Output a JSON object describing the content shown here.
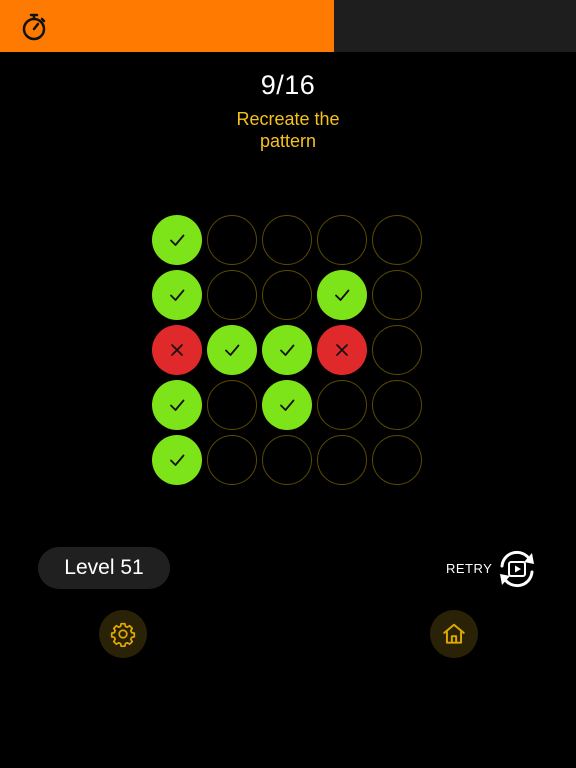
{
  "timer": {
    "remaining_fraction": 0.58,
    "icon": "stopwatch-icon"
  },
  "progress": {
    "text": "9/16"
  },
  "instruction": "Recreate the pattern",
  "grid": {
    "size": 5,
    "cells": [
      "correct",
      "empty",
      "empty",
      "empty",
      "empty",
      "correct",
      "empty",
      "empty",
      "correct",
      "empty",
      "wrong",
      "correct",
      "correct",
      "wrong",
      "empty",
      "correct",
      "empty",
      "correct",
      "empty",
      "empty",
      "correct",
      "empty",
      "empty",
      "empty",
      "empty"
    ]
  },
  "level": {
    "label": "Level 51"
  },
  "retry": {
    "label": "RETRY",
    "icon": "retry-video-icon"
  },
  "buttons": {
    "settings_icon": "gear-icon",
    "home_icon": "home-icon"
  },
  "colors": {
    "timer_fill": "#ff7a00",
    "correct": "#7ee41a",
    "wrong": "#e0292a",
    "instruction": "#f6c21a",
    "accent_icon": "#e0a800"
  }
}
